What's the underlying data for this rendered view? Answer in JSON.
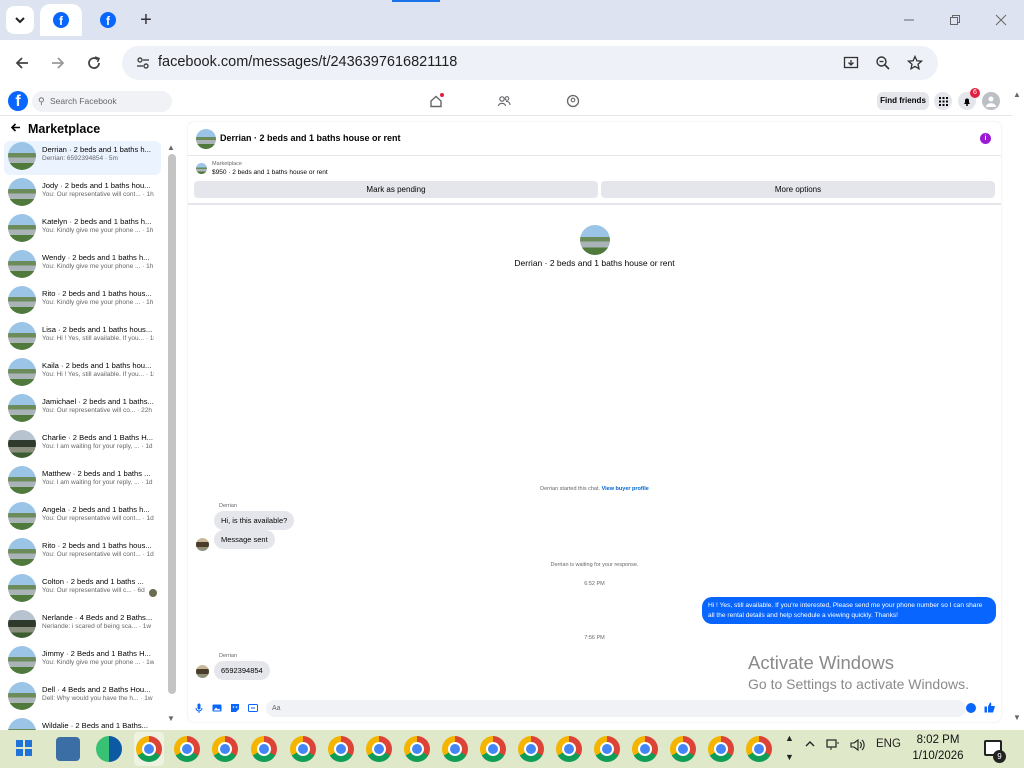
{
  "browser": {
    "url": "facebook.com/messages/t/2436397616821118",
    "new_tab": "+",
    "tab_dropdown": "⌄"
  },
  "fb_header": {
    "logo": "f",
    "search_placeholder": "Search Facebook",
    "find_friends": "Find friends",
    "notification_count": "6"
  },
  "sidebar": {
    "title": "Marketplace",
    "conversations": [
      {
        "name": "Derrian · 2 beds and 1 baths h...",
        "preview": "Derrian: 6592394854 · 5m",
        "selected": true
      },
      {
        "name": "Jody · 2 beds and 1 baths hou...",
        "preview": "You: Our representative will cont... · 1h"
      },
      {
        "name": "Katelyn · 2 beds and 1 baths h...",
        "preview": "You: Kindly give me your phone ... · 1h"
      },
      {
        "name": "Wendy · 2 beds and 1 baths h...",
        "preview": "You: Kindly give me your phone ... · 1h"
      },
      {
        "name": "Rito · 2 beds and 1 baths hous...",
        "preview": "You: Kindly give me your phone ... · 1h"
      },
      {
        "name": "Lisa · 2 beds and 1 baths hous...",
        "preview": "You: Hi ! Yes, still available. If you... · 1h"
      },
      {
        "name": "Kaila · 2 beds and 1 baths hou...",
        "preview": "You: Hi ! Yes, still available. If you... · 1h"
      },
      {
        "name": "Jamichael · 2 beds and 1 baths...",
        "preview": "You: Our representative will co... · 22h"
      },
      {
        "name": "Charlie · 2 Beds and 1 Baths H...",
        "preview": "You: I am waiting for your reply, ... · 1d"
      },
      {
        "name": "Matthew · 2 beds and 1 baths ...",
        "preview": "You: I am waiting for your reply, ... · 1d"
      },
      {
        "name": "Angela · 2 beds and 1 baths h...",
        "preview": "You: Our representative will cont... · 1d"
      },
      {
        "name": "Rito · 2 beds and 1 baths hous...",
        "preview": "You: Our representative will cont... · 1d"
      },
      {
        "name": "Colton · 2 beds and 1 baths ...",
        "preview": "You: Our representative will c... · 6d"
      },
      {
        "name": "Nerlande · 4 Beds and 2 Baths...",
        "preview": "Nerlande: i scared of being sca... · 1w"
      },
      {
        "name": "Jimmy · 2 Beds and 1 Baths H...",
        "preview": "You: Kindly give me your phone ... · 1w"
      },
      {
        "name": "Dell · 4 Beds and 2 Baths Hou...",
        "preview": "Dell: Why would you have the h... · 1w"
      },
      {
        "name": "Wildalie · 2 Beds and 1 Baths...",
        "preview": ""
      }
    ]
  },
  "chat": {
    "title": "Derrian · 2 beds and 1 baths house or rent",
    "listing_source": "Marketplace",
    "listing_item": "$950 · 2 beds and 1 baths house or rent",
    "mark_pending": "Mark as pending",
    "more_options": "More options",
    "center_title": "Derrian · 2 beds and 1 baths house or rent",
    "started_text": "Derrian started this chat.",
    "view_profile": "View buyer profile",
    "sender_1": "Derrian",
    "msg_1": "Hi, is this available?",
    "msg_2": "Message sent",
    "waiting_text": "Derrian is waiting for your response.",
    "time_1": "6:52 PM",
    "outgoing": "Hi ! Yes, still available. If you're interested, Please send me your phone number so I can share all the rental details and help schedule a viewing quickly. Thanks!",
    "time_2": "7:56 PM",
    "sender_2": "Derrian",
    "msg_3": "6592394854",
    "composer_placeholder": "Aa"
  },
  "watermark": {
    "line1": "Activate Windows",
    "line2": "Go to Settings to activate Windows."
  },
  "taskbar": {
    "time": "8:02 PM",
    "date": "1/10/2026",
    "language": "ENG",
    "notification_count": "9"
  }
}
